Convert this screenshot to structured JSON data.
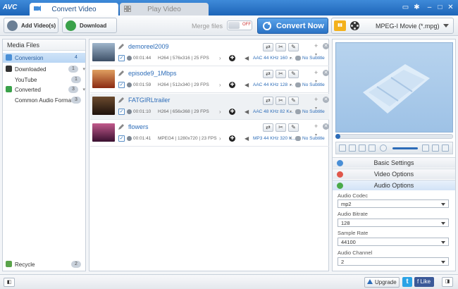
{
  "app": {
    "logo": "AVC"
  },
  "tabs": [
    {
      "label": "Convert Video"
    },
    {
      "label": "Play Video"
    }
  ],
  "toolbar": {
    "add_videos_label": "Add Video(s)",
    "download_label": "Download",
    "merge_label": "Merge files",
    "merge_toggle": "OFF",
    "convert_now_label": "Convert Now",
    "format_label": "MPEG-I Movie (*.mpg)"
  },
  "sidebar": {
    "title": "Media Files",
    "items": [
      {
        "label": "Conversion",
        "count": "4"
      },
      {
        "label": "Downloaded",
        "count": "1"
      },
      {
        "label": "YouTube",
        "count": "1"
      },
      {
        "label": "Converted",
        "count": "3"
      },
      {
        "label": "Common Audio Formats",
        "count": "3"
      }
    ],
    "recycle": {
      "label": "Recycle",
      "count": "2"
    }
  },
  "files": [
    {
      "name": "demoreel2009",
      "duration": "00:01:44",
      "video": "H264 | 576x316 | 25 FPS",
      "audio": "AAC 44 KHz 160 ...",
      "subtitle": "No Subtitle"
    },
    {
      "name": "episode9_1Mbps",
      "duration": "00:01:59",
      "video": "H264 | 512x340 | 29 FPS",
      "audio": "AAC 44 KHz 128 ...",
      "subtitle": "No Subtitle"
    },
    {
      "name": "FATGIRLtrailer",
      "duration": "00:01:10",
      "video": "H264 | 656x368 | 29 FPS",
      "audio": "AAC 48 KHz 82 K...",
      "subtitle": "No Subtitle"
    },
    {
      "name": "flowers",
      "duration": "00:01:41",
      "video": "MPEG4 | 1280x720 | 23 FPS",
      "audio": "MP3 44 KHz 320 K...",
      "subtitle": "No Subtitle"
    }
  ],
  "settings": {
    "basic": "Basic Settings",
    "video": "Video Options",
    "audio": "Audio Options",
    "options": [
      {
        "label": "Audio Codec",
        "value": "mp2"
      },
      {
        "label": "Audio Bitrate",
        "value": "128"
      },
      {
        "label": "Sample Rate",
        "value": "44100"
      },
      {
        "label": "Audio Channel",
        "value": "2"
      }
    ]
  },
  "statusbar": {
    "upgrade": "Upgrade",
    "twitter": "t",
    "facebook": "f Like"
  },
  "colors": {
    "accent": "#2c6cb8",
    "title_bar": "#1d65b8"
  }
}
